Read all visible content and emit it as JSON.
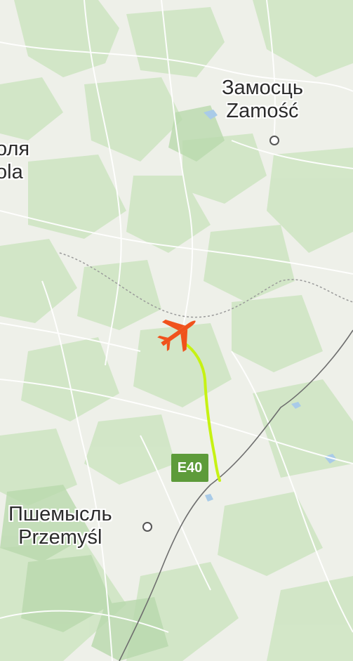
{
  "map": {
    "cities": [
      {
        "id": "zamosc",
        "name_cyrillic": "Замосць",
        "name_latin": "Zamość"
      },
      {
        "id": "przemysl",
        "name_cyrillic": "Пшемысль",
        "name_latin": "Przemyśl"
      },
      {
        "id": "partial-left",
        "name_cyrillic": "оля",
        "name_latin": "ola"
      }
    ],
    "road_shield": "E40",
    "colors": {
      "land": "#eef0e9",
      "forest": "#cfe6c4",
      "flight_path": "#c6f213",
      "plane": "#f0521c",
      "road_shield": "#5d9b3a",
      "border": "#777777"
    },
    "icons": {
      "aircraft": "airplane-icon",
      "city_marker": "city-dot-icon"
    }
  }
}
